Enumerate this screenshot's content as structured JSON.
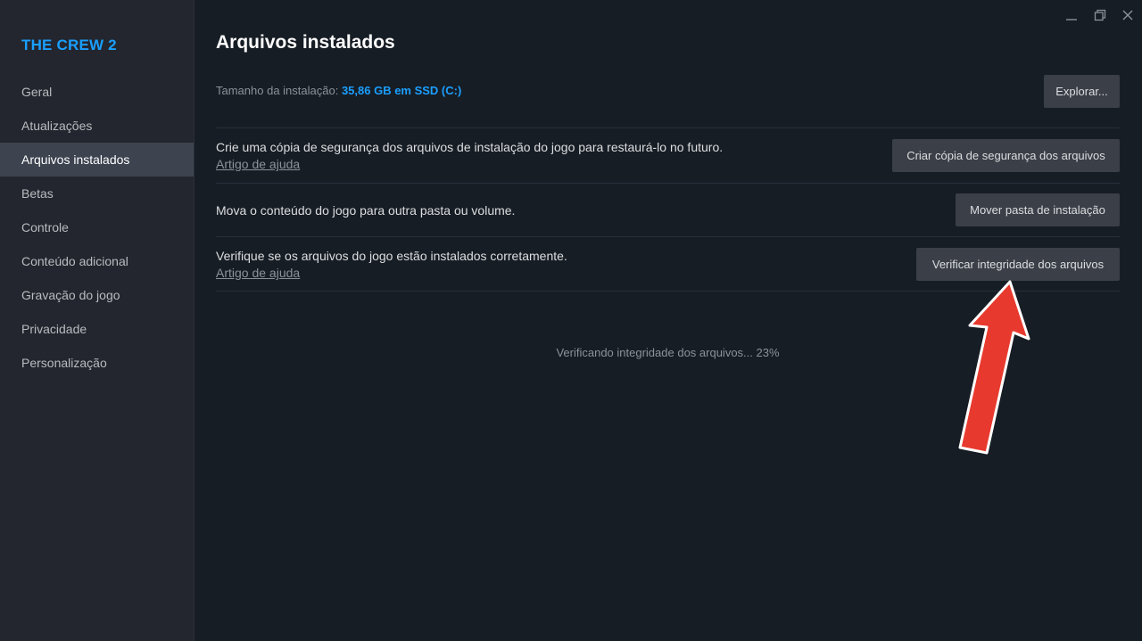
{
  "sidebar": {
    "game_title": "THE CREW 2",
    "items": [
      {
        "label": "Geral"
      },
      {
        "label": "Atualizações"
      },
      {
        "label": "Arquivos instalados"
      },
      {
        "label": "Betas"
      },
      {
        "label": "Controle"
      },
      {
        "label": "Conteúdo adicional"
      },
      {
        "label": "Gravação do jogo"
      },
      {
        "label": "Privacidade"
      },
      {
        "label": "Personalização"
      }
    ],
    "active_index": 2
  },
  "main": {
    "title": "Arquivos instalados",
    "install_size_label": "Tamanho da instalação:",
    "install_size_value": "35,86 GB em SSD (C:)",
    "browse_button": "Explorar...",
    "rows": [
      {
        "text": "Crie uma cópia de segurança dos arquivos de instalação do jogo para restaurá-lo no futuro.",
        "help_link": "Artigo de ajuda",
        "button": "Criar cópia de segurança dos arquivos"
      },
      {
        "text": "Mova o conteúdo do jogo para outra pasta ou volume.",
        "button": "Mover pasta de instalação"
      },
      {
        "text": "Verifique se os arquivos do jogo estão instalados corretamente.",
        "help_link": "Artigo de ajuda",
        "button": "Verificar integridade dos arquivos"
      }
    ],
    "progress_text": "Verificando integridade dos arquivos... 23%",
    "progress_percent": 23
  },
  "window_controls": [
    "minimize-icon",
    "restore-icon",
    "close-icon"
  ],
  "colors": {
    "accent": "#1a9fff",
    "background": "#171d25",
    "sidebar": "#23262e",
    "button": "#3a3f48",
    "arrow": "#e8392e"
  }
}
